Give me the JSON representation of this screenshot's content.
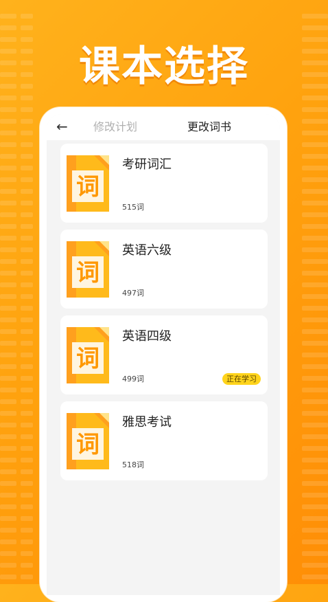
{
  "hero": {
    "title": "课本选择"
  },
  "nav": {
    "back_icon": "arrow-left-icon",
    "tabs": [
      {
        "label": "修改计划",
        "active": false
      },
      {
        "label": "更改词书",
        "active": true
      }
    ]
  },
  "cover": {
    "glyph": "词",
    "icon": "book-cover-icon"
  },
  "books": [
    {
      "title": "考研词汇",
      "count": "515词",
      "status": ""
    },
    {
      "title": "英语六级",
      "count": "497词",
      "status": ""
    },
    {
      "title": "英语四级",
      "count": "499词",
      "status": "正在学习"
    },
    {
      "title": "雅思考试",
      "count": "518词",
      "status": ""
    }
  ],
  "colors": {
    "background": "#ffa20e",
    "cover_orange": "#ffa01e",
    "cover_yellow": "#ffcf1a",
    "badge": "#ffd41c",
    "tab_inactive": "#b0b0b0",
    "tab_active": "#222222"
  }
}
